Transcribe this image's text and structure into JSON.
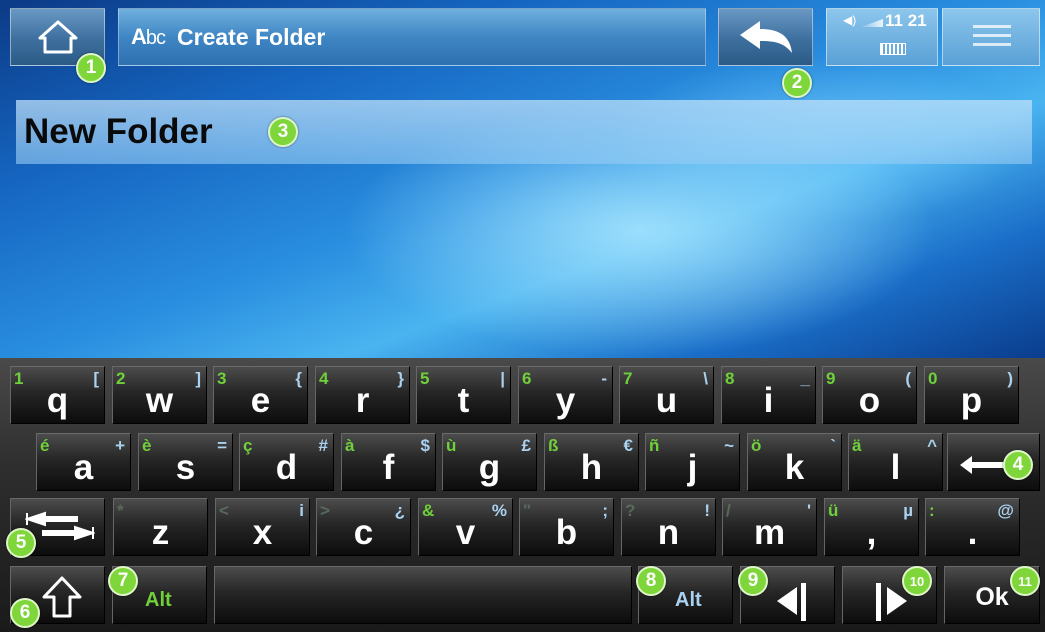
{
  "header": {
    "title_prefix": "A",
    "title_prefix_small": "bc",
    "title": "Create Folder",
    "time": "11 21"
  },
  "input": {
    "value": "New Folder"
  },
  "callouts": [
    "1",
    "2",
    "3",
    "4",
    "5",
    "6",
    "7",
    "8",
    "9",
    "10",
    "11"
  ],
  "keyboard": {
    "row1": [
      {
        "main": "q",
        "tl": "1",
        "tr": "["
      },
      {
        "main": "w",
        "tl": "2",
        "tr": "]"
      },
      {
        "main": "e",
        "tl": "3",
        "tr": "{"
      },
      {
        "main": "r",
        "tl": "4",
        "tr": "}"
      },
      {
        "main": "t",
        "tl": "5",
        "tr": "|"
      },
      {
        "main": "y",
        "tl": "6",
        "tr": "-"
      },
      {
        "main": "u",
        "tl": "7",
        "tr": "\\"
      },
      {
        "main": "i",
        "tl": "8",
        "tr": "_"
      },
      {
        "main": "o",
        "tl": "9",
        "tr": "("
      },
      {
        "main": "p",
        "tl": "0",
        "tr": ")"
      }
    ],
    "row2": [
      {
        "main": "a",
        "tl": "é",
        "tr": "+"
      },
      {
        "main": "s",
        "tl": "è",
        "tr": "="
      },
      {
        "main": "d",
        "tl": "ç",
        "tr": "#"
      },
      {
        "main": "f",
        "tl": "à",
        "tr": "$"
      },
      {
        "main": "g",
        "tl": "ù",
        "tr": "£"
      },
      {
        "main": "h",
        "tl": "ß",
        "tr": "€"
      },
      {
        "main": "j",
        "tl": "ñ",
        "tr": "~"
      },
      {
        "main": "k",
        "tl": "ö",
        "tr": "`"
      },
      {
        "main": "l",
        "tl": "ä",
        "tr": "^"
      }
    ],
    "row3": [
      {
        "main": "z",
        "tl": "*",
        "tr": ""
      },
      {
        "main": "x",
        "tl": "<",
        "tr": "i"
      },
      {
        "main": "c",
        "tl": ">",
        "tr": "¿"
      },
      {
        "main": "v",
        "tl": "&",
        "tr": "%"
      },
      {
        "main": "b",
        "tl": "\"",
        "tr": ";"
      },
      {
        "main": "n",
        "tl": "?",
        "tr": "!"
      },
      {
        "main": "m",
        "tl": "/",
        "tr": "'"
      },
      {
        "main": ",",
        "tl": "ü",
        "tr": "µ"
      },
      {
        "main": ".",
        "tl": ":",
        "tr": "@"
      }
    ],
    "alt_left": "Alt",
    "alt_right": "Alt",
    "ok": "Ok"
  }
}
